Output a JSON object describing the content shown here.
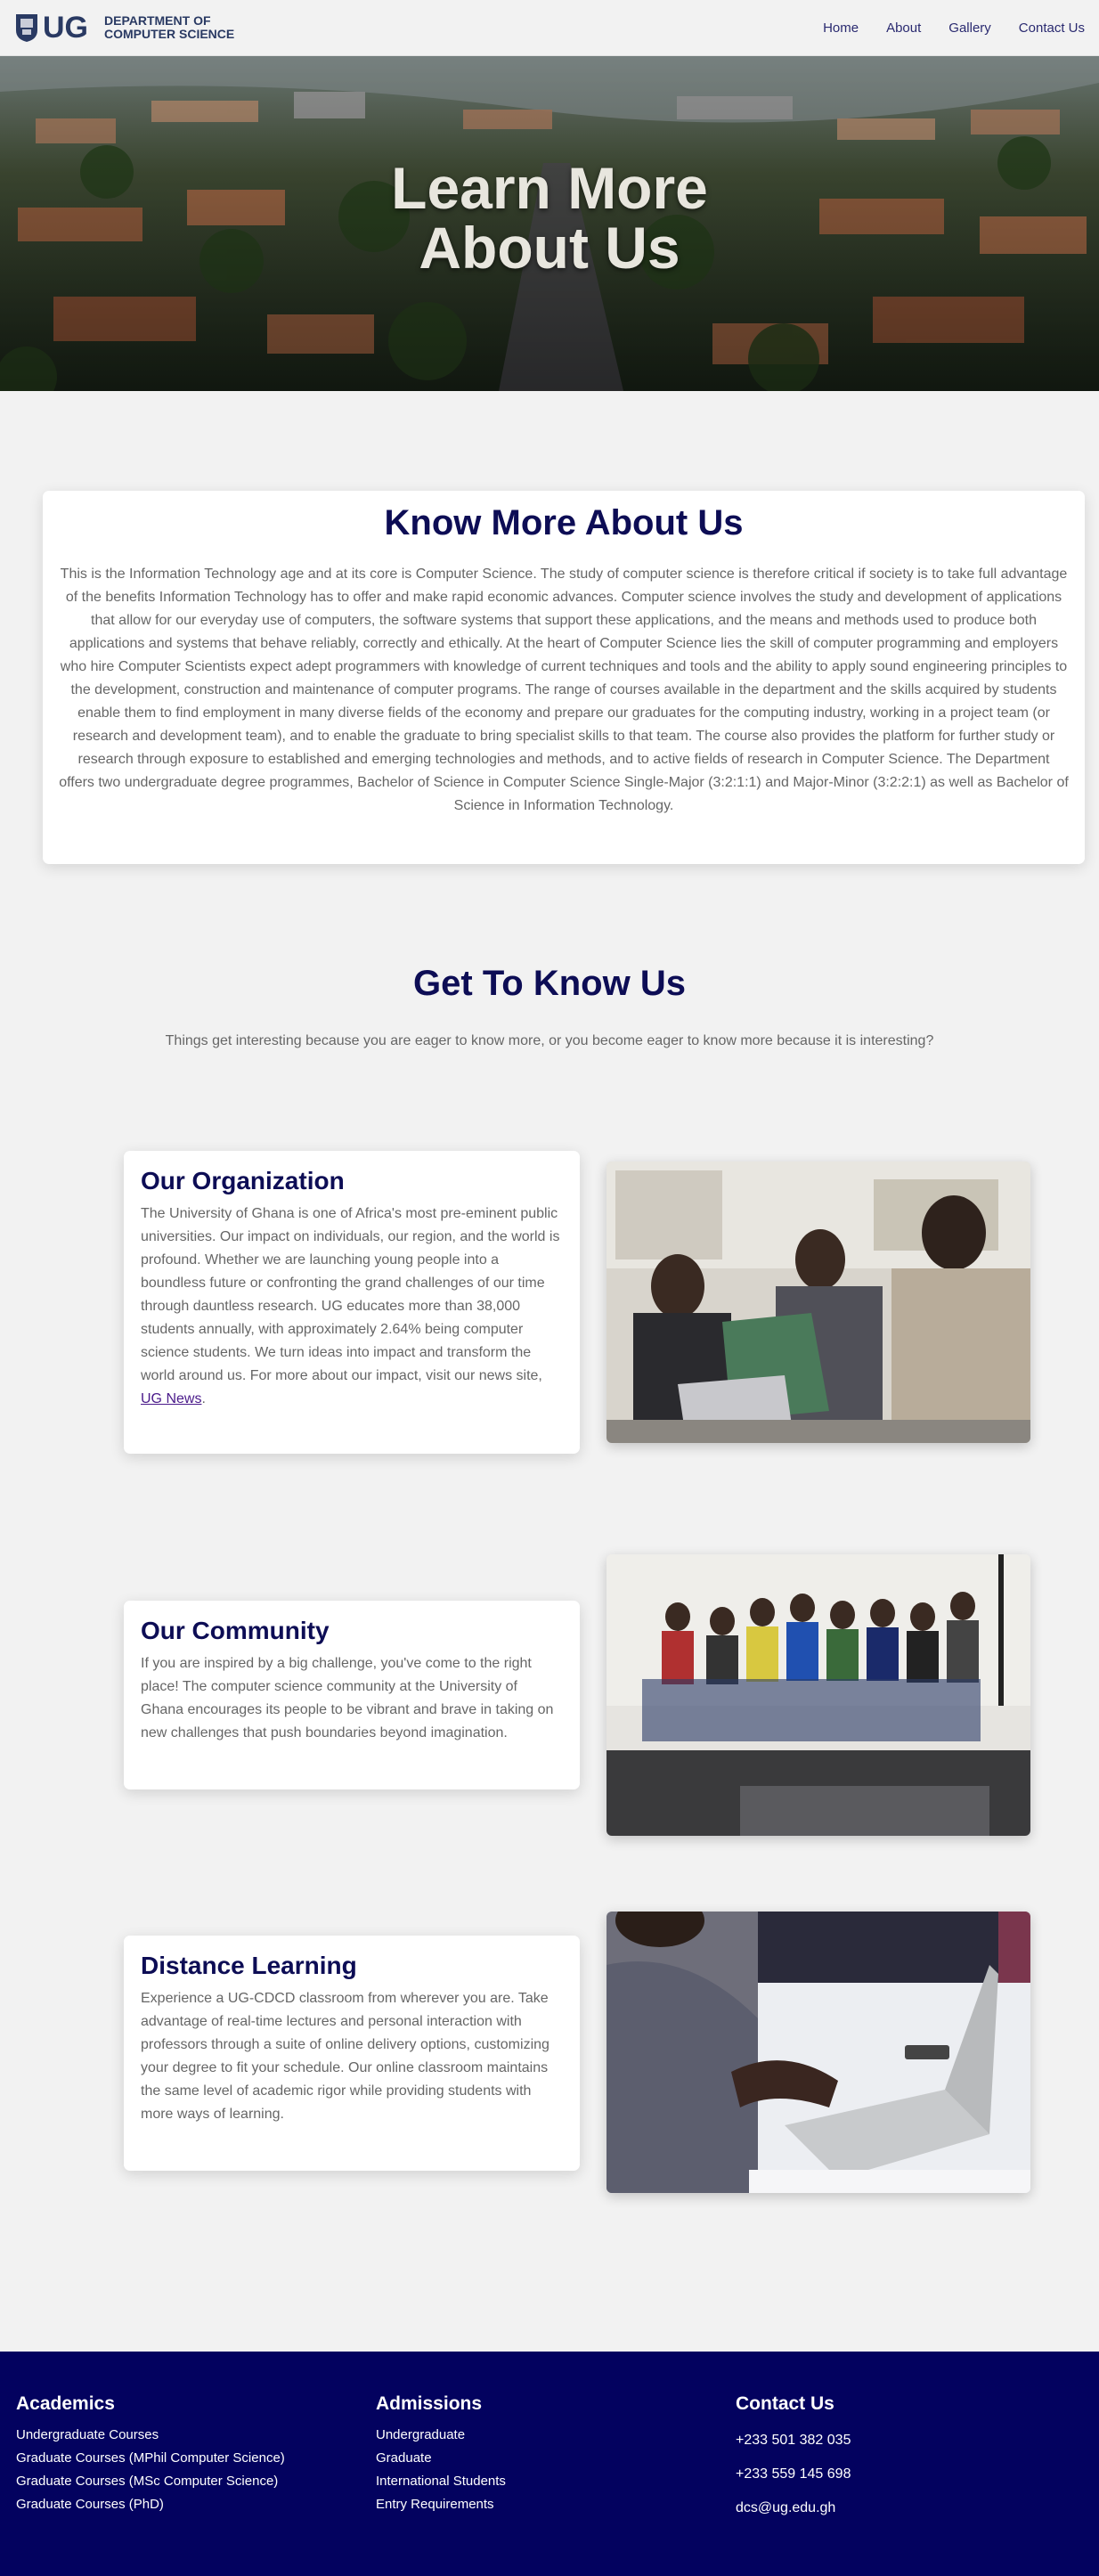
{
  "header": {
    "logo_text": "UG",
    "dept_line1": "DEPARTMENT OF",
    "dept_line2": "COMPUTER SCIENCE",
    "nav": [
      "Home",
      "About",
      "Gallery",
      "Contact Us"
    ]
  },
  "hero": {
    "title_line1": "Learn More",
    "title_line2": "About Us"
  },
  "about": {
    "title": "Know More About Us",
    "body": "This is the Information Technology age and at its core is Computer Science. The study of computer science is therefore critical if society is to take full advantage of the benefits Information Technology has to offer and make rapid economic advances. Computer science involves the study and development of applications that allow for our everyday use of computers, the software systems that support these applications, and the means and methods used to produce both applications and systems that behave reliably, correctly and ethically. At the heart of Computer Science lies the skill of computer programming and employers who hire Computer Scientists expect adept programmers with knowledge of current techniques and tools and the ability to apply sound engineering principles to the development, construction and maintenance of computer programs. The range of courses available in the department and the skills acquired by students enable them to find employment in many diverse fields of the economy and prepare our graduates for the computing industry, working in a project team (or research and development team), and to enable the graduate to bring specialist skills to that team. The course also provides the platform for further study or research through exposure to established and emerging technologies and methods, and to active fields of research in Computer Science. The Department offers two undergraduate degree programmes, Bachelor of Science in Computer Science Single-Major (3:2:1:1) and Major-Minor (3:2:2:1) as well as Bachelor of Science in Information Technology."
  },
  "get_to_know": {
    "title": "Get To Know Us",
    "subtitle": "Things get interesting because you are eager to know more, or you become eager to know more because it is interesting?"
  },
  "sections": {
    "organization": {
      "title": "Our Organization",
      "body": "The University of Ghana is one of Africa's most pre-eminent public universities. Our impact on individuals, our region, and the world is profound. Whether we are launching young people into a boundless future or confronting the grand challenges of our time through dauntless research. UG educates more than 38,000 students annually, with approximately 2.64% being computer science students. We turn ideas into impact and transform the world around us. For more about our impact, visit our news site,",
      "link": "UG News",
      "end": "."
    },
    "community": {
      "title": "Our Community",
      "body": "If you are inspired by a big challenge, you've come to the right place! The computer science community at the University of Ghana encourages its people to be vibrant and brave in taking on new challenges that push boundaries beyond imagination."
    },
    "distance": {
      "title": "Distance Learning",
      "body": "Experience a UG-CDCD classroom from wherever you are. Take advantage of real-time lectures and personal interaction with professors through a suite of online delivery options, customizing your degree to fit your schedule. Our online classroom maintains the same level of academic rigor while providing students with more ways of learning."
    }
  },
  "footer": {
    "academics": {
      "title": "Academics",
      "items": [
        "Undergraduate Courses",
        "Graduate Courses (MPhil Computer Science)",
        "Graduate Courses (MSc Computer Science)",
        "Graduate Courses (PhD)"
      ]
    },
    "admissions": {
      "title": "Admissions",
      "items": [
        "Undergraduate",
        "Graduate",
        "International Students",
        "Entry Requirements"
      ]
    },
    "contact": {
      "title": "Contact Us",
      "items": [
        "+233 501 382 035",
        "+233 559 145 698",
        "dcs@ug.edu.gh"
      ]
    }
  },
  "colors": {
    "navy": "#0d0d55",
    "footer_bg": "#03025f",
    "page_bg": "#f2f2f2"
  }
}
